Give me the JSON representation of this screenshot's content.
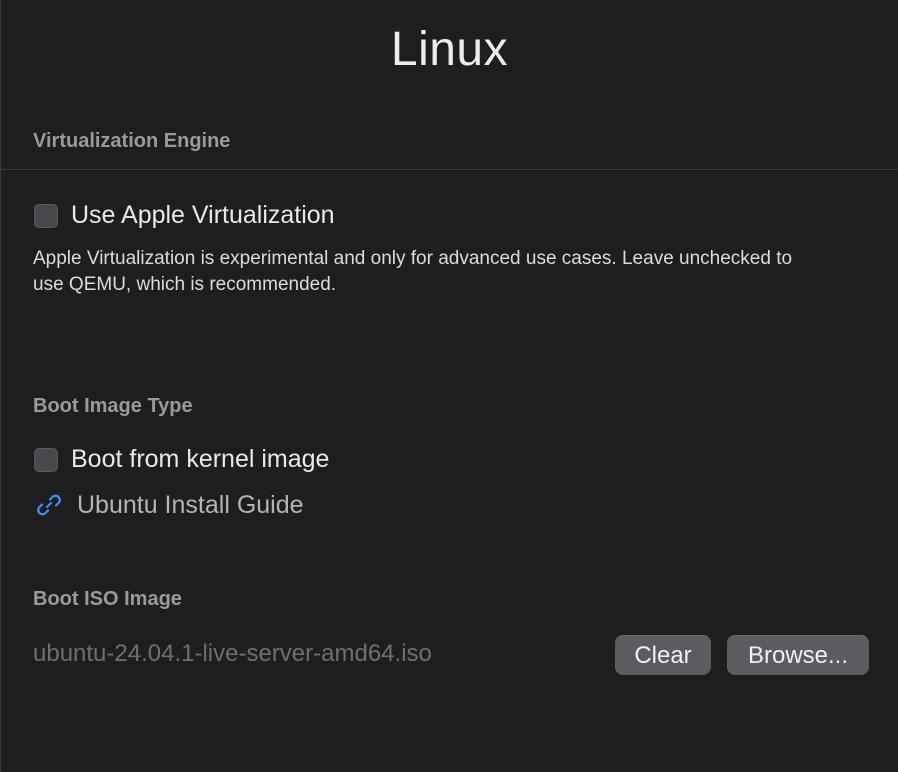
{
  "window": {
    "title": "Linux"
  },
  "virtualization": {
    "header": "Virtualization Engine",
    "checkbox_label": "Use Apple Virtualization",
    "checked": false,
    "description": "Apple Virtualization is experimental and only for advanced use cases. Leave unchecked to use QEMU, which is recommended."
  },
  "boot_image_type": {
    "header": "Boot Image Type",
    "checkbox_label": "Boot from kernel image",
    "checked": false,
    "link_label": "Ubuntu Install Guide",
    "link_icon": "link-icon"
  },
  "boot_iso": {
    "header": "Boot ISO Image",
    "value": "ubuntu-24.04.1-live-server-amd64.iso",
    "clear_label": "Clear",
    "browse_label": "Browse..."
  },
  "colors": {
    "background": "#1e1e21",
    "link_icon": "#4a8cf7",
    "button": "#5c5c60"
  }
}
